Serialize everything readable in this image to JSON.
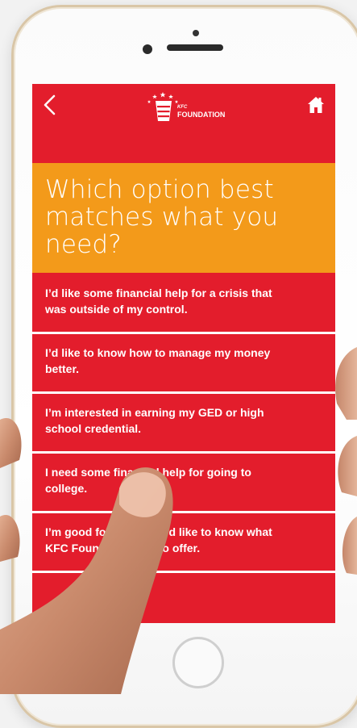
{
  "app": {
    "logo": {
      "brand_small": "KFC",
      "brand_large": "FOUNDATION"
    }
  },
  "header": {
    "back_icon": "chevron-left-icon",
    "home_icon": "home-icon"
  },
  "question": {
    "text": "Which option best matches what you need?"
  },
  "options": [
    {
      "label": "I’d like some financial help for a crisis that was outside of my control."
    },
    {
      "label": "I’d like to know how to manage my money better."
    },
    {
      "label": "I’m interested in earning my GED or high school credential."
    },
    {
      "label": "I need some financial help for going to college."
    },
    {
      "label": "I’m good for now, but I’d like to know what KFC Foundation has to offer."
    }
  ],
  "colors": {
    "primary_red": "#e31d2c",
    "accent_orange": "#f39a1a",
    "text_white": "#ffffff"
  }
}
